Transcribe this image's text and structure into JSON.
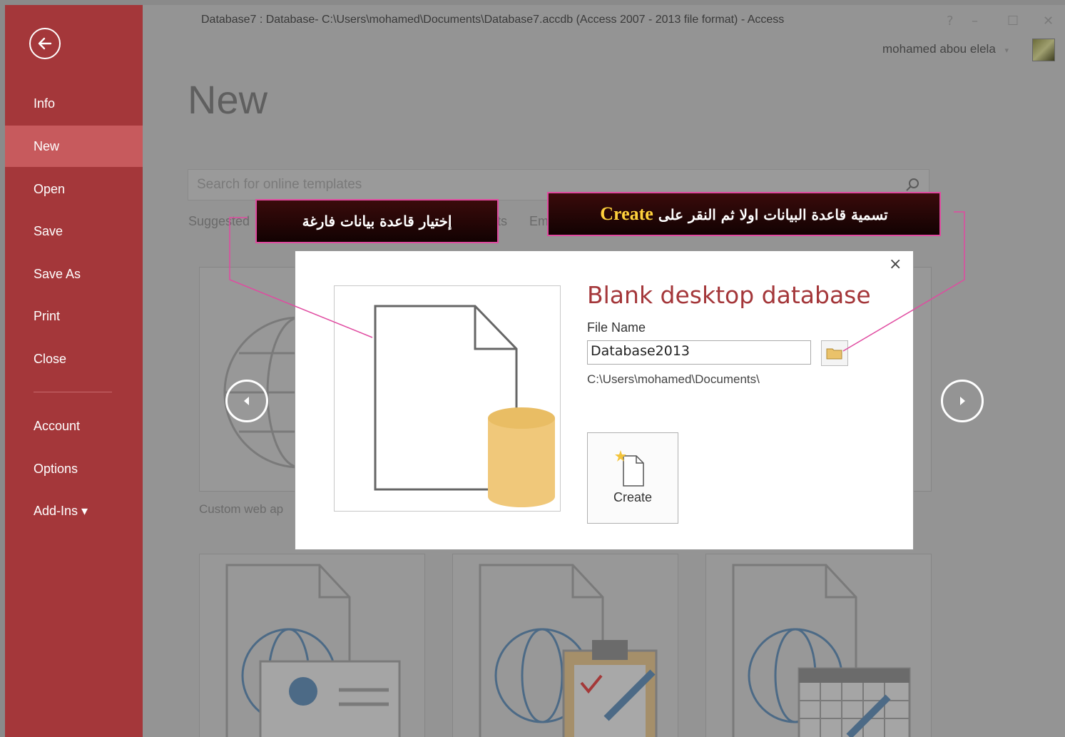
{
  "window": {
    "title": "Database7 : Database- C:\\Users\\mohamed\\Documents\\Database7.accdb (Access 2007 - 2013 file format) - Access",
    "help": "?",
    "minimize": "–",
    "restore": "☐",
    "close": "✕",
    "user": "mohamed abou elela",
    "user_caret": "▾"
  },
  "sidebar": {
    "items": [
      {
        "label": "Info"
      },
      {
        "label": "New"
      },
      {
        "label": "Open"
      },
      {
        "label": "Save"
      },
      {
        "label": "Save As"
      },
      {
        "label": "Print"
      },
      {
        "label": "Close"
      },
      {
        "label": "Account"
      },
      {
        "label": "Options"
      },
      {
        "label": "Add-Ins ▾"
      }
    ],
    "active": "New",
    "background_color": "#a4373a",
    "active_color": "#c75a5d"
  },
  "main": {
    "page_title": "New",
    "search_placeholder": "Search for online templates",
    "suggested_label": "Suggested",
    "suggested_partial_1": "ts",
    "suggested_partial_2": "Em",
    "tile_label": "Custom web ap"
  },
  "dialog": {
    "heading": "Blank desktop database",
    "file_name_label": "File Name",
    "file_name_value": "Database2013",
    "path": "C:\\Users\\mohamed\\Documents\\",
    "create_label": "Create",
    "close": "×",
    "accent_color": "#a4373a"
  },
  "callouts": {
    "left_text": "إختيار قاعدة بيانات فارغة",
    "right_text_arabic": "تسمية قاعدة البيانات اولا ثم النقر على",
    "right_text_highlight": "Create",
    "border_color": "#e04aa0",
    "highlight_color": "#ffd23c"
  }
}
